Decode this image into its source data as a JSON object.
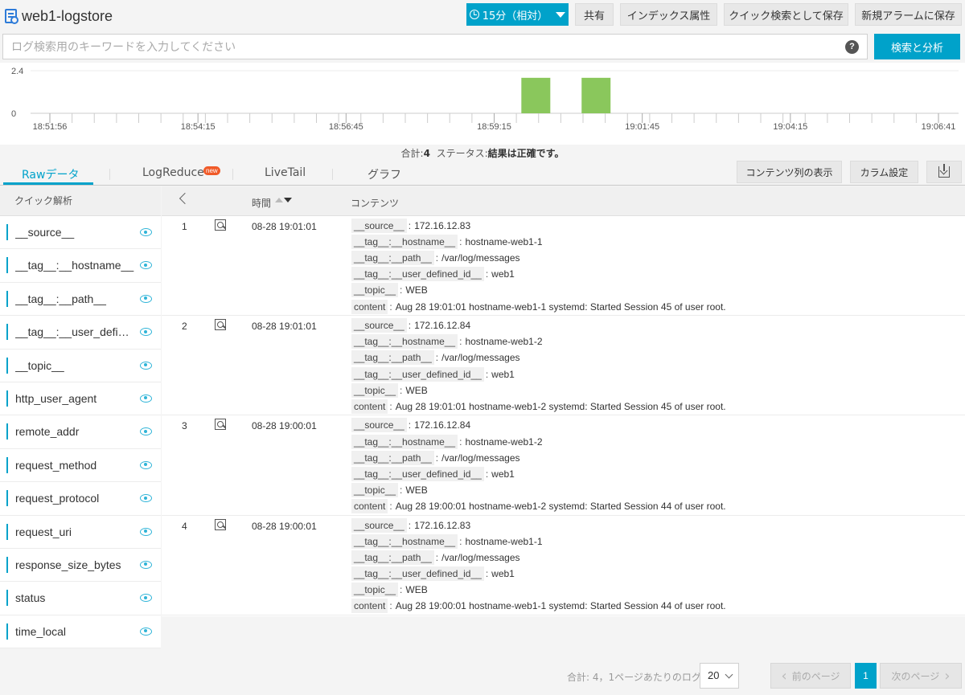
{
  "header": {
    "title": "web1-logstore",
    "time_range": "15分（相対）",
    "share": "共有",
    "index_attr": "インデックス属性",
    "save_quick_search": "クイック検索として保存",
    "save_alarm": "新規アラームに保存"
  },
  "search": {
    "placeholder": "ログ検索用のキーワードを入力してください",
    "value": "",
    "help": "?",
    "button": "検索と分析"
  },
  "histogram": {
    "y_ticks": [
      "2.4",
      "0"
    ],
    "x_ticks": [
      "18:51:56",
      "18:54:15",
      "18:56:45",
      "18:59:15",
      "19:01:45",
      "19:04:15",
      "19:06:41"
    ],
    "bar_color": "#8ac75c",
    "bars": [
      {
        "time": "19:00",
        "count": 2
      },
      {
        "time": "19:01",
        "count": 2
      }
    ]
  },
  "summary": {
    "total_label": "合計:",
    "total": "4",
    "status_label": "ステータス:",
    "status": "結果は正確です。"
  },
  "tabs": [
    {
      "label": "Rawデータ",
      "active": true
    },
    {
      "label": "LogReduce",
      "badge": "new"
    },
    {
      "label": "LiveTail"
    },
    {
      "label": "グラフ"
    }
  ],
  "toolbar": {
    "show_content_columns": "コンテンツ列の表示",
    "column_settings": "カラム設定"
  },
  "sidebar": {
    "title": "クイック解析",
    "fields": [
      "__source__",
      "__tag__:__hostname__",
      "__tag__:__path__",
      "__tag__:__user_defined_id__",
      "__topic__",
      "http_user_agent",
      "remote_addr",
      "request_method",
      "request_protocol",
      "request_uri",
      "response_size_bytes",
      "status",
      "time_local"
    ]
  },
  "table": {
    "col_time": "時間",
    "col_content": "コンテンツ",
    "rows": [
      {
        "index": "1",
        "time": "08-28 19:01:01",
        "fields": [
          {
            "key": "__source__",
            "value": "172.16.12.83"
          },
          {
            "key": "__tag__:__hostname__",
            "value": "hostname-web1-1"
          },
          {
            "key": "__tag__:__path__",
            "value": "/var/log/messages"
          },
          {
            "key": "__tag__:__user_defined_id__",
            "value": "web1"
          },
          {
            "key": "__topic__",
            "value": "WEB"
          },
          {
            "key": "content",
            "value": "Aug 28 19:01:01 hostname-web1-1 systemd: Started Session 45 of user root."
          }
        ]
      },
      {
        "index": "2",
        "time": "08-28 19:01:01",
        "fields": [
          {
            "key": "__source__",
            "value": "172.16.12.84"
          },
          {
            "key": "__tag__:__hostname__",
            "value": "hostname-web1-2"
          },
          {
            "key": "__tag__:__path__",
            "value": "/var/log/messages"
          },
          {
            "key": "__tag__:__user_defined_id__",
            "value": "web1"
          },
          {
            "key": "__topic__",
            "value": "WEB"
          },
          {
            "key": "content",
            "value": "Aug 28 19:01:01 hostname-web1-2 systemd: Started Session 45 of user root."
          }
        ]
      },
      {
        "index": "3",
        "time": "08-28 19:00:01",
        "fields": [
          {
            "key": "__source__",
            "value": "172.16.12.84"
          },
          {
            "key": "__tag__:__hostname__",
            "value": "hostname-web1-2"
          },
          {
            "key": "__tag__:__path__",
            "value": "/var/log/messages"
          },
          {
            "key": "__tag__:__user_defined_id__",
            "value": "web1"
          },
          {
            "key": "__topic__",
            "value": "WEB"
          },
          {
            "key": "content",
            "value": "Aug 28 19:00:01 hostname-web1-2 systemd: Started Session 44 of user root."
          }
        ]
      },
      {
        "index": "4",
        "time": "08-28 19:00:01",
        "fields": [
          {
            "key": "__source__",
            "value": "172.16.12.83"
          },
          {
            "key": "__tag__:__hostname__",
            "value": "hostname-web1-1"
          },
          {
            "key": "__tag__:__path__",
            "value": "/var/log/messages"
          },
          {
            "key": "__tag__:__user_defined_id__",
            "value": "web1"
          },
          {
            "key": "__topic__",
            "value": "WEB"
          },
          {
            "key": "content",
            "value": "Aug 28 19:00:01 hostname-web1-1 systemd: Started Session 44 of user root."
          }
        ]
      }
    ]
  },
  "pagination": {
    "info": "合計: 4，1ページあたりのログ",
    "page_size": "20",
    "prev": "前のページ",
    "current": "1",
    "next": "次のページ"
  },
  "colors": {
    "accent": "#00a2ca",
    "bar": "#8ac75c",
    "badge": "#f05a28"
  }
}
